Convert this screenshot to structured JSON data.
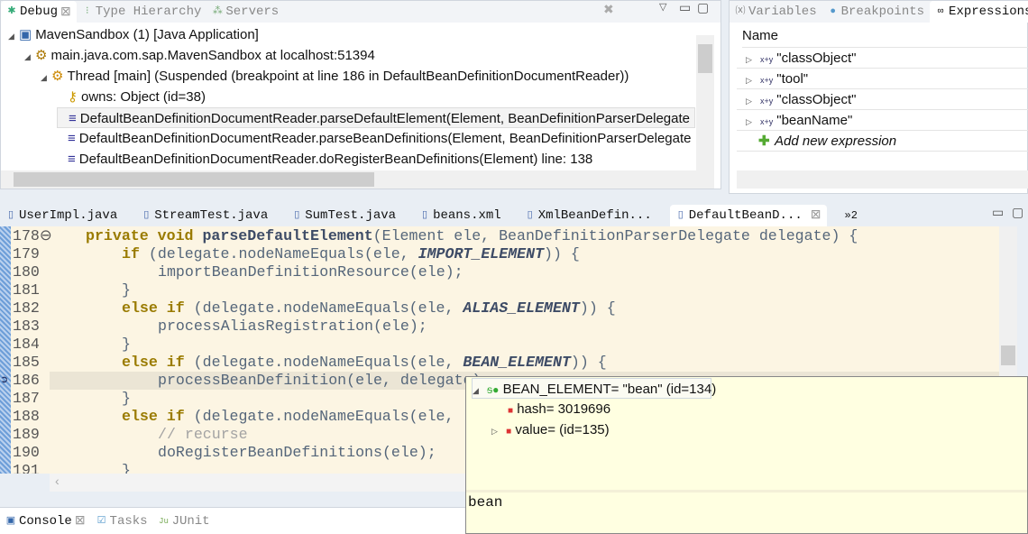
{
  "debug_panel": {
    "tabs": [
      {
        "label": "Debug",
        "icon": "bug-icon",
        "active": true
      },
      {
        "label": "Type Hierarchy",
        "icon": "hierarchy-icon"
      },
      {
        "label": "Servers",
        "icon": "servers-icon"
      }
    ],
    "tree": [
      {
        "label": "MavenSandbox (1) [Java Application]",
        "icon": "java-app-icon",
        "expanded": true,
        "level": 0
      },
      {
        "label": "main.java.com.sap.MavenSandbox at localhost:51394",
        "icon": "debug-target-icon",
        "expanded": true,
        "level": 1
      },
      {
        "label": "Thread [main] (Suspended (breakpoint at line 186 in DefaultBeanDefinitionDocumentReader))",
        "icon": "thread-suspended-icon",
        "expanded": true,
        "level": 2
      },
      {
        "label": "owns: Object  (id=38)",
        "icon": "key-icon",
        "level": 3
      },
      {
        "label": "DefaultBeanDefinitionDocumentReader.parseDefaultElement(Element, BeanDefinitionParserDelegate",
        "icon": "stack-frame-icon",
        "level": 3,
        "selected": true
      },
      {
        "label": "DefaultBeanDefinitionDocumentReader.parseBeanDefinitions(Element, BeanDefinitionParserDelegate",
        "icon": "stack-frame-icon",
        "level": 3
      },
      {
        "label": "DefaultBeanDefinitionDocumentReader.doRegisterBeanDefinitions(Element) line: 138",
        "icon": "stack-frame-icon",
        "level": 3
      }
    ]
  },
  "expressions_panel": {
    "tabs": [
      {
        "label": "Variables"
      },
      {
        "label": "Breakpoints"
      },
      {
        "label": "Expressions",
        "active": true
      }
    ],
    "column": "Name",
    "items": [
      "\"classObject\"",
      "\"tool\"",
      "\"classObject\"",
      "\"beanName\""
    ],
    "add_label": "Add new expression"
  },
  "editor": {
    "tabs": [
      {
        "label": "UserImpl.java"
      },
      {
        "label": "StreamTest.java"
      },
      {
        "label": "SumTest.java"
      },
      {
        "label": "beans.xml"
      },
      {
        "label": "XmlBeanDefin..."
      },
      {
        "label": "DefaultBeanD...",
        "active": true
      }
    ],
    "overflow": "»2",
    "lines": [
      {
        "n": "178⊖",
        "html": "<span class=\"kw\">private void </span><span class=\"md\">parseDefaultElement</span>(Element ele, BeanDefinitionParserDelegate delegate) {",
        "indent": 0
      },
      {
        "n": "179",
        "html": "<span class=\"kw\">if</span> (delegate.nodeNameEquals(ele, <span class=\"cst\">IMPORT_ELEMENT</span>)) {",
        "indent": 1
      },
      {
        "n": "180",
        "html": "importBeanDefinitionResource(ele);",
        "indent": 2
      },
      {
        "n": "181",
        "html": "}",
        "indent": 1
      },
      {
        "n": "182",
        "html": "<span class=\"kw\">else if</span> (delegate.nodeNameEquals(ele, <span class=\"cst\">ALIAS_ELEMENT</span>)) {",
        "indent": 1
      },
      {
        "n": "183",
        "html": "processAliasRegistration(ele);",
        "indent": 2
      },
      {
        "n": "184",
        "html": "}",
        "indent": 1
      },
      {
        "n": "185",
        "html": "<span class=\"kw\">else if</span> (delegate.nodeNameEquals(ele, <span class=\"cst\">BEAN_ELEMENT</span>)) {",
        "indent": 1
      },
      {
        "n": "186",
        "html": "processBeanDefinition(ele, delegate);",
        "indent": 2,
        "current": true
      },
      {
        "n": "187",
        "html": "}",
        "indent": 1
      },
      {
        "n": "188",
        "html": "<span class=\"kw\">else if</span> (delegate.nodeNameEquals(ele, ",
        "indent": 1
      },
      {
        "n": "189",
        "html": "<span class=\"cm\">// recurse</span>",
        "indent": 2
      },
      {
        "n": "190",
        "html": "doRegisterBeanDefinitions(ele);",
        "indent": 2
      },
      {
        "n": "191",
        "html": "}",
        "indent": 1
      }
    ]
  },
  "hover": {
    "root": "BEAN_ELEMENT= \"bean\" (id=134)",
    "children": [
      {
        "label": "hash= 3019696"
      },
      {
        "label": "value= (id=135)"
      }
    ],
    "detail": "bean"
  },
  "bottom": {
    "tabs": [
      {
        "label": "Console",
        "active": true
      },
      {
        "label": "Tasks"
      },
      {
        "label": "JUnit"
      }
    ]
  }
}
